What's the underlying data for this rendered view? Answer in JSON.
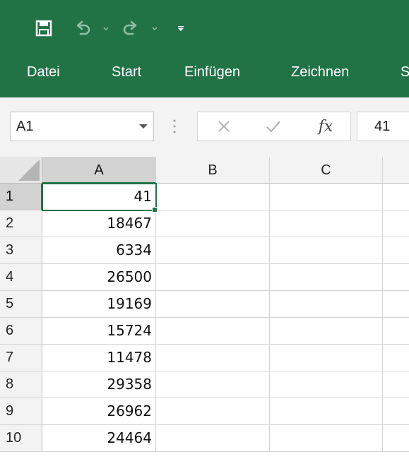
{
  "ribbon": {
    "tabs": [
      {
        "label": "Datei"
      },
      {
        "label": "Start"
      },
      {
        "label": "Einfügen"
      },
      {
        "label": "Zeichnen"
      },
      {
        "label": "S"
      }
    ]
  },
  "name_box": {
    "value": "A1"
  },
  "formula_bar": {
    "fx_label": "fx",
    "value": "41"
  },
  "sheet": {
    "columns": [
      "A",
      "B",
      "C"
    ],
    "rows": [
      {
        "num": "1",
        "a": "41"
      },
      {
        "num": "2",
        "a": "18467"
      },
      {
        "num": "3",
        "a": "6334"
      },
      {
        "num": "4",
        "a": "26500"
      },
      {
        "num": "5",
        "a": "19169"
      },
      {
        "num": "6",
        "a": "15724"
      },
      {
        "num": "7",
        "a": "11478"
      },
      {
        "num": "8",
        "a": "29358"
      },
      {
        "num": "9",
        "a": "26962"
      },
      {
        "num": "10",
        "a": "24464"
      }
    ]
  },
  "colors": {
    "accent": "#217346",
    "ribbon_text": "#ffffff"
  },
  "icons": [
    "save-icon",
    "undo-icon",
    "redo-icon",
    "customize-icon",
    "chevron-down-icon",
    "cancel-icon",
    "enter-icon",
    "fx-icon"
  ]
}
